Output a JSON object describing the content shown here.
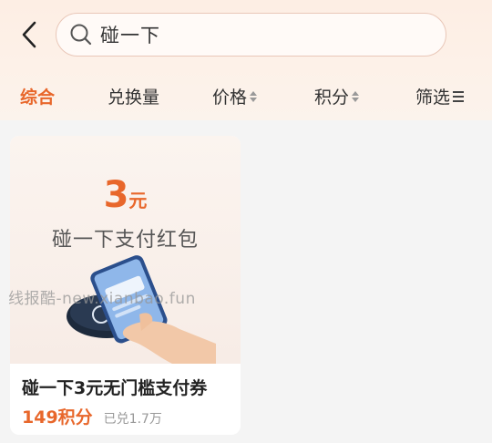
{
  "search": {
    "query": "碰一下"
  },
  "sort_tabs": [
    {
      "label": "综合",
      "active": true
    },
    {
      "label": "兑换量",
      "active": false
    },
    {
      "label": "价格",
      "active": false
    },
    {
      "label": "积分",
      "active": false
    },
    {
      "label": "筛选",
      "active": false
    }
  ],
  "product": {
    "promo_amount": "3",
    "promo_unit": "元",
    "promo_title": "碰一下支付红包",
    "title": "碰一下3元无门槛支付券",
    "price": "149积分",
    "sold": "已兑1.7万"
  },
  "watermark": "线报酷-new.xianbao.fun",
  "colors": {
    "accent": "#e8672b",
    "header_bg": "#fdeee4",
    "page_bg": "#f4f4f4"
  },
  "icons": [
    "back-arrow-icon",
    "search-icon",
    "sort-triangle-icon",
    "filter-icon"
  ]
}
